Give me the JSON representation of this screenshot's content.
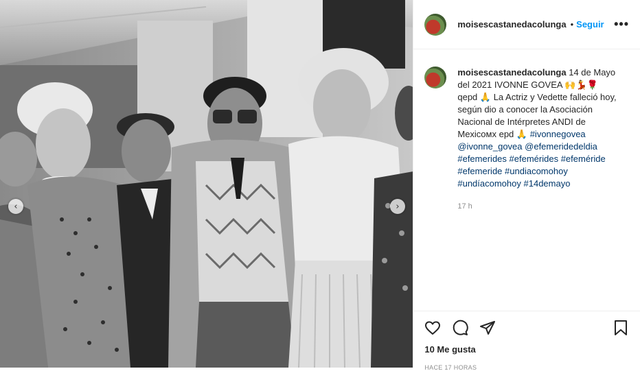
{
  "post": {
    "username": "moisescastanedacolunga",
    "separator": "•",
    "follow_label": "Seguir",
    "more_label": "•••",
    "caption": {
      "username": "moisescastanedacolunga",
      "text": "14 de Mayo del 2021 IVONNE GOVEA 🙌💃🌹 qepd 🙏 La Actriz y Vedette falleció hoy, según dio a conocer la Asociación Nacional de Intérpretes ANDI de Mexicoмx epd 🙏",
      "tags": [
        "#ivonnegovea",
        "@ivonne_govea",
        "@efemeridedeldia",
        "#efemerides",
        "#efemérides",
        "#efeméride",
        "#efemeride",
        "#undiacomohoy",
        "#undíacomohoy",
        "#14demayo"
      ],
      "time": "17 h"
    },
    "likes": "10 Me gusta",
    "posted_ago": "HACE 17 HORAS",
    "icons": {
      "like": "heart-icon",
      "comment": "comment-icon",
      "share": "paper-plane-icon",
      "save": "bookmark-icon",
      "prev": "chevron-left-icon",
      "next": "chevron-right-icon"
    },
    "colors": {
      "link": "#00376b",
      "follow": "#0095f6",
      "muted": "#8e8e8e"
    }
  }
}
